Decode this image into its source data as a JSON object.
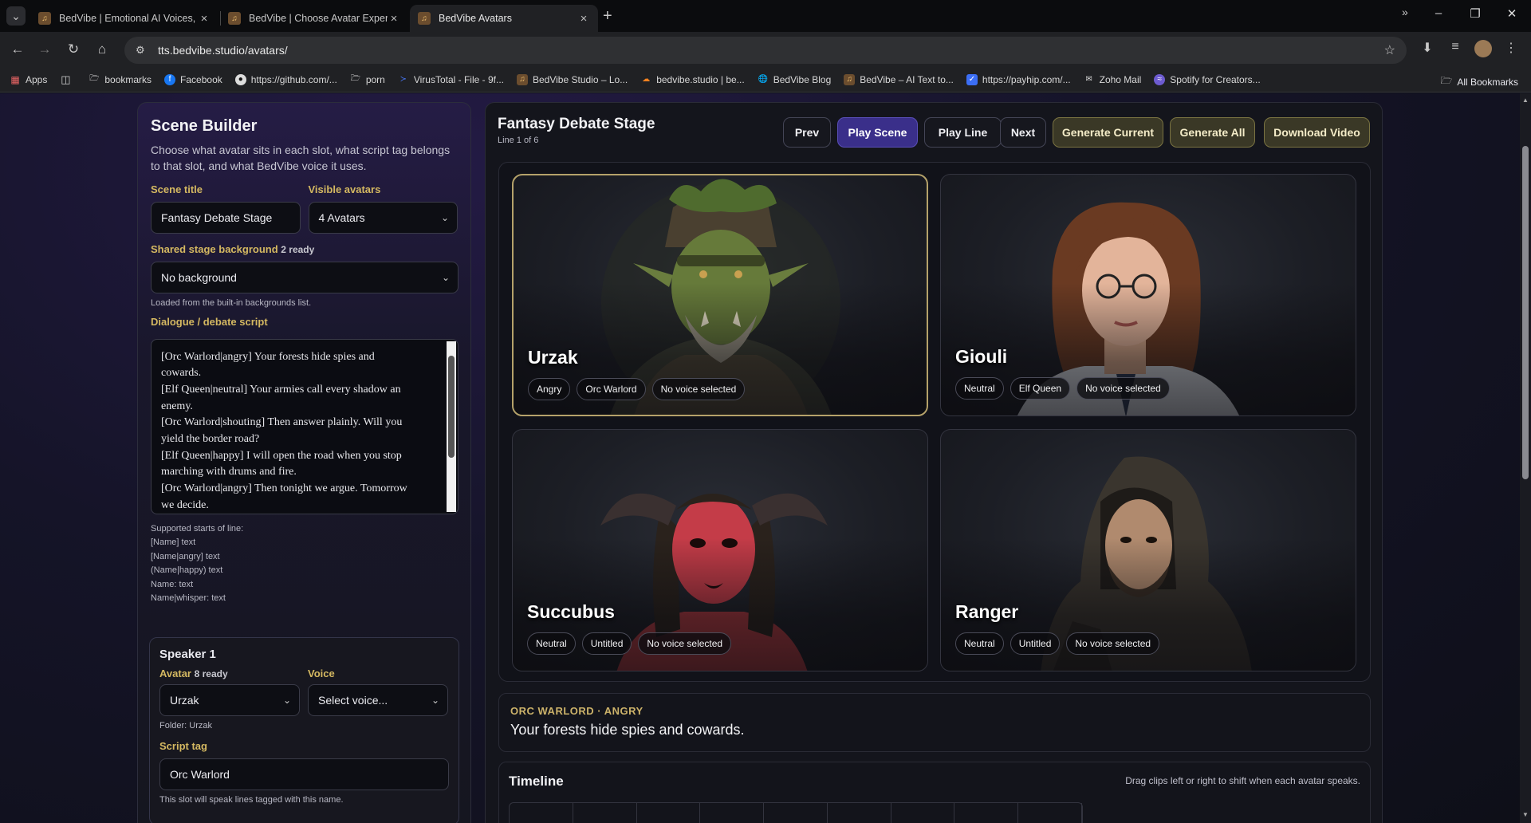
{
  "browser": {
    "tabs": [
      {
        "title": "BedVibe | Emotional AI Voices, I"
      },
      {
        "title": "BedVibe | Choose Avatar Experi"
      },
      {
        "title": "BedVibe Avatars"
      }
    ],
    "url": "tts.bedvibe.studio/avatars/",
    "bookmarks": [
      "Apps",
      "bookmarks",
      "Facebook",
      "https://github.com/...",
      "porn",
      "VirusTotal - File - 9f...",
      "BedVibe Studio – Lo...",
      "bedvibe.studio | be...",
      "BedVibe Blog",
      "BedVibe – AI Text to...",
      "https://payhip.com/...",
      "Zoho Mail",
      "Spotify for Creators..."
    ],
    "all_bookmarks": "All Bookmarks"
  },
  "builder": {
    "title": "Scene Builder",
    "description": "Choose what avatar sits in each slot, what script tag belongs to that slot, and what BedVibe voice it uses.",
    "scene_title_label": "Scene title",
    "scene_title_value": "Fantasy Debate Stage",
    "visible_avatars_label": "Visible avatars",
    "visible_avatars_value": "4 Avatars",
    "background_label": "Shared stage background",
    "background_count": "2 ready",
    "background_value": "No background",
    "background_note": "Loaded from the built-in backgrounds list.",
    "script_label": "Dialogue / debate script",
    "script_lines": [
      "[Orc Warlord|angry] Your forests hide spies and",
      "cowards.",
      "[Elf Queen|neutral] Your armies call every shadow an",
      "enemy.",
      "[Orc Warlord|shouting] Then answer plainly. Will you",
      "yield the border road?",
      "[Elf Queen|happy] I will open the road when you stop",
      "marching with drums and fire.",
      "[Orc Warlord|angry] Then tonight we argue. Tomorrow",
      "we decide."
    ],
    "supported_title": "Supported starts of line:",
    "supported": [
      "[Name] text",
      "[Name|angry] text",
      "(Name|happy) text",
      "Name: text",
      "Name|whisper: text"
    ],
    "speaker": {
      "title": "Speaker 1",
      "avatar_label": "Avatar",
      "avatar_count": "8 ready",
      "avatar_value": "Urzak",
      "voice_label": "Voice",
      "voice_value": "Select voice...",
      "folder": "Folder: Urzak",
      "tag_label": "Script tag",
      "tag_value": "Orc Warlord",
      "tag_note": "This slot will speak lines tagged with this name."
    }
  },
  "stage": {
    "title": "Fantasy Debate Stage",
    "line_info": "Line 1 of 6",
    "buttons": {
      "prev": "Prev",
      "play_scene": "Play Scene",
      "play_line": "Play Line",
      "next": "Next",
      "generate_current": "Generate Current",
      "generate_all": "Generate All",
      "download": "Download Video"
    },
    "cards": [
      {
        "name": "Urzak",
        "emotion": "Angry",
        "tag": "Orc Warlord",
        "voice": "No voice selected"
      },
      {
        "name": "Giouli",
        "emotion": "Neutral",
        "tag": "Elf Queen",
        "voice": "No voice selected"
      },
      {
        "name": "Succubus",
        "emotion": "Neutral",
        "tag": "Untitled",
        "voice": "No voice selected"
      },
      {
        "name": "Ranger",
        "emotion": "Neutral",
        "tag": "Untitled",
        "voice": "No voice selected"
      }
    ],
    "current_line": {
      "tag": "ORC WARLORD · ANGRY",
      "text": "Your forests hide spies and cowards."
    },
    "timeline": {
      "title": "Timeline",
      "hint": "Drag clips left or right to shift when each avatar speaks."
    }
  }
}
